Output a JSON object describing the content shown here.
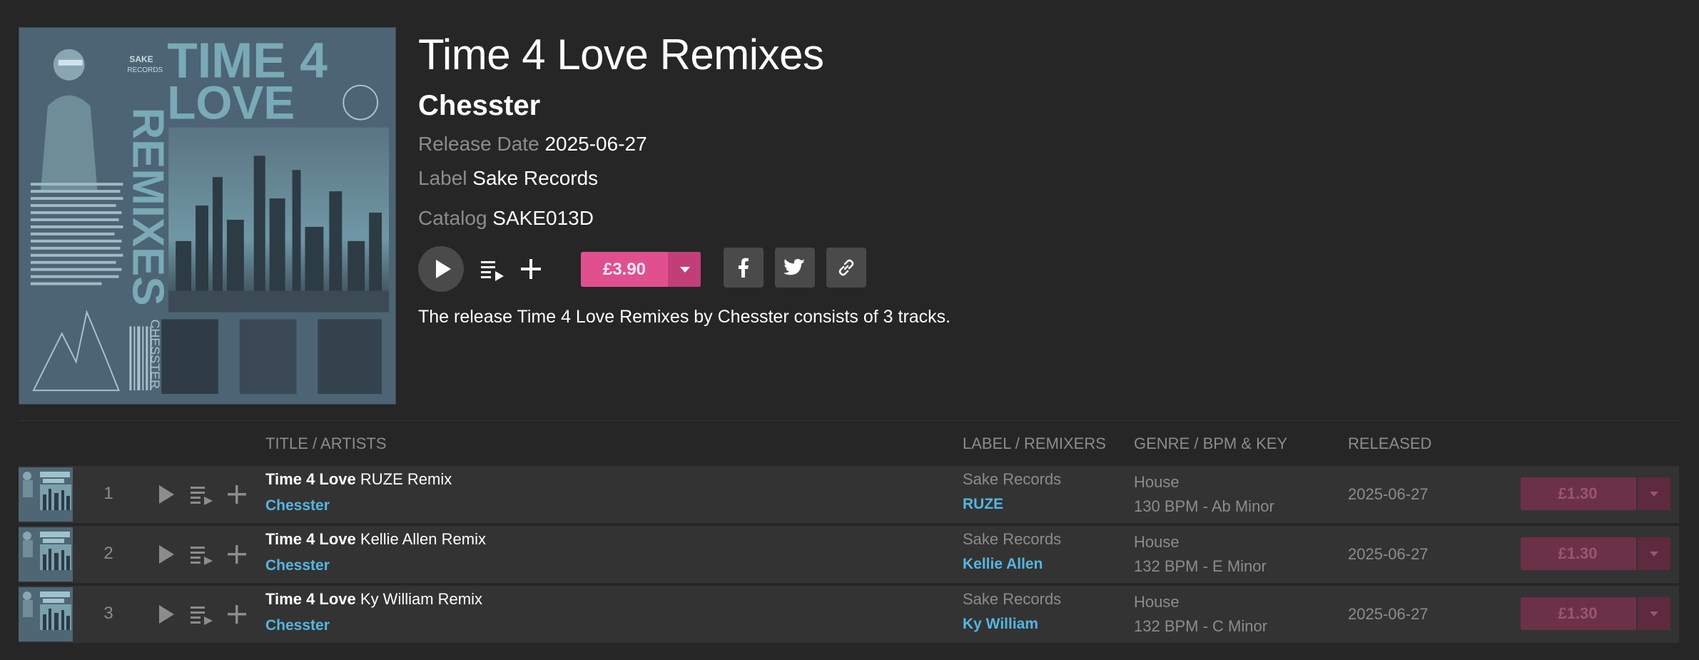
{
  "release": {
    "title": "Time 4 Love Remixes",
    "artist": "Chesster",
    "release_date_label": "Release Date",
    "release_date": "2025-06-27",
    "label_label": "Label",
    "label": "Sake Records",
    "catalog_label": "Catalog",
    "catalog": "SAKE013D",
    "price": "£3.90",
    "description": "The release Time 4 Love Remixes by Chesster consists of 3 tracks."
  },
  "artwork": {
    "title_line1": "TIME 4",
    "title_line2": "LOVE",
    "side_text": "REMIXES",
    "artist_vertical": "CHESSTER",
    "logo_line1": "SAKE",
    "logo_line2": "RECORDS"
  },
  "table": {
    "headers": {
      "title": "TITLE / ARTISTS",
      "label": "LABEL / REMIXERS",
      "genre": "GENRE / BPM & KEY",
      "released": "RELEASED"
    },
    "tracks": [
      {
        "num": "1",
        "title": "Time 4 Love",
        "mix": "RUZE Remix",
        "artist": "Chesster",
        "label": "Sake Records",
        "remixer": "RUZE",
        "genre": "House",
        "bpm_key": "130 BPM - Ab Minor",
        "released": "2025-06-27",
        "price": "£1.30"
      },
      {
        "num": "2",
        "title": "Time 4 Love",
        "mix": "Kellie Allen Remix",
        "artist": "Chesster",
        "label": "Sake Records",
        "remixer": "Kellie Allen",
        "genre": "House",
        "bpm_key": "132 BPM - E Minor",
        "released": "2025-06-27",
        "price": "£1.30"
      },
      {
        "num": "3",
        "title": "Time 4 Love",
        "mix": "Ky William Remix",
        "artist": "Chesster",
        "label": "Sake Records",
        "remixer": "Ky William",
        "genre": "House",
        "bpm_key": "132 BPM - C Minor",
        "released": "2025-06-27",
        "price": "£1.30"
      }
    ]
  },
  "colors": {
    "background": "#262626",
    "row_background": "#333333",
    "accent_pink": "#e0508e",
    "link_blue": "#55b6e0",
    "muted_text": "#8c8c8c"
  },
  "icons": [
    "play-icon",
    "queue-icon",
    "plus-icon",
    "caret-down-icon",
    "facebook-icon",
    "twitter-icon",
    "link-icon"
  ]
}
